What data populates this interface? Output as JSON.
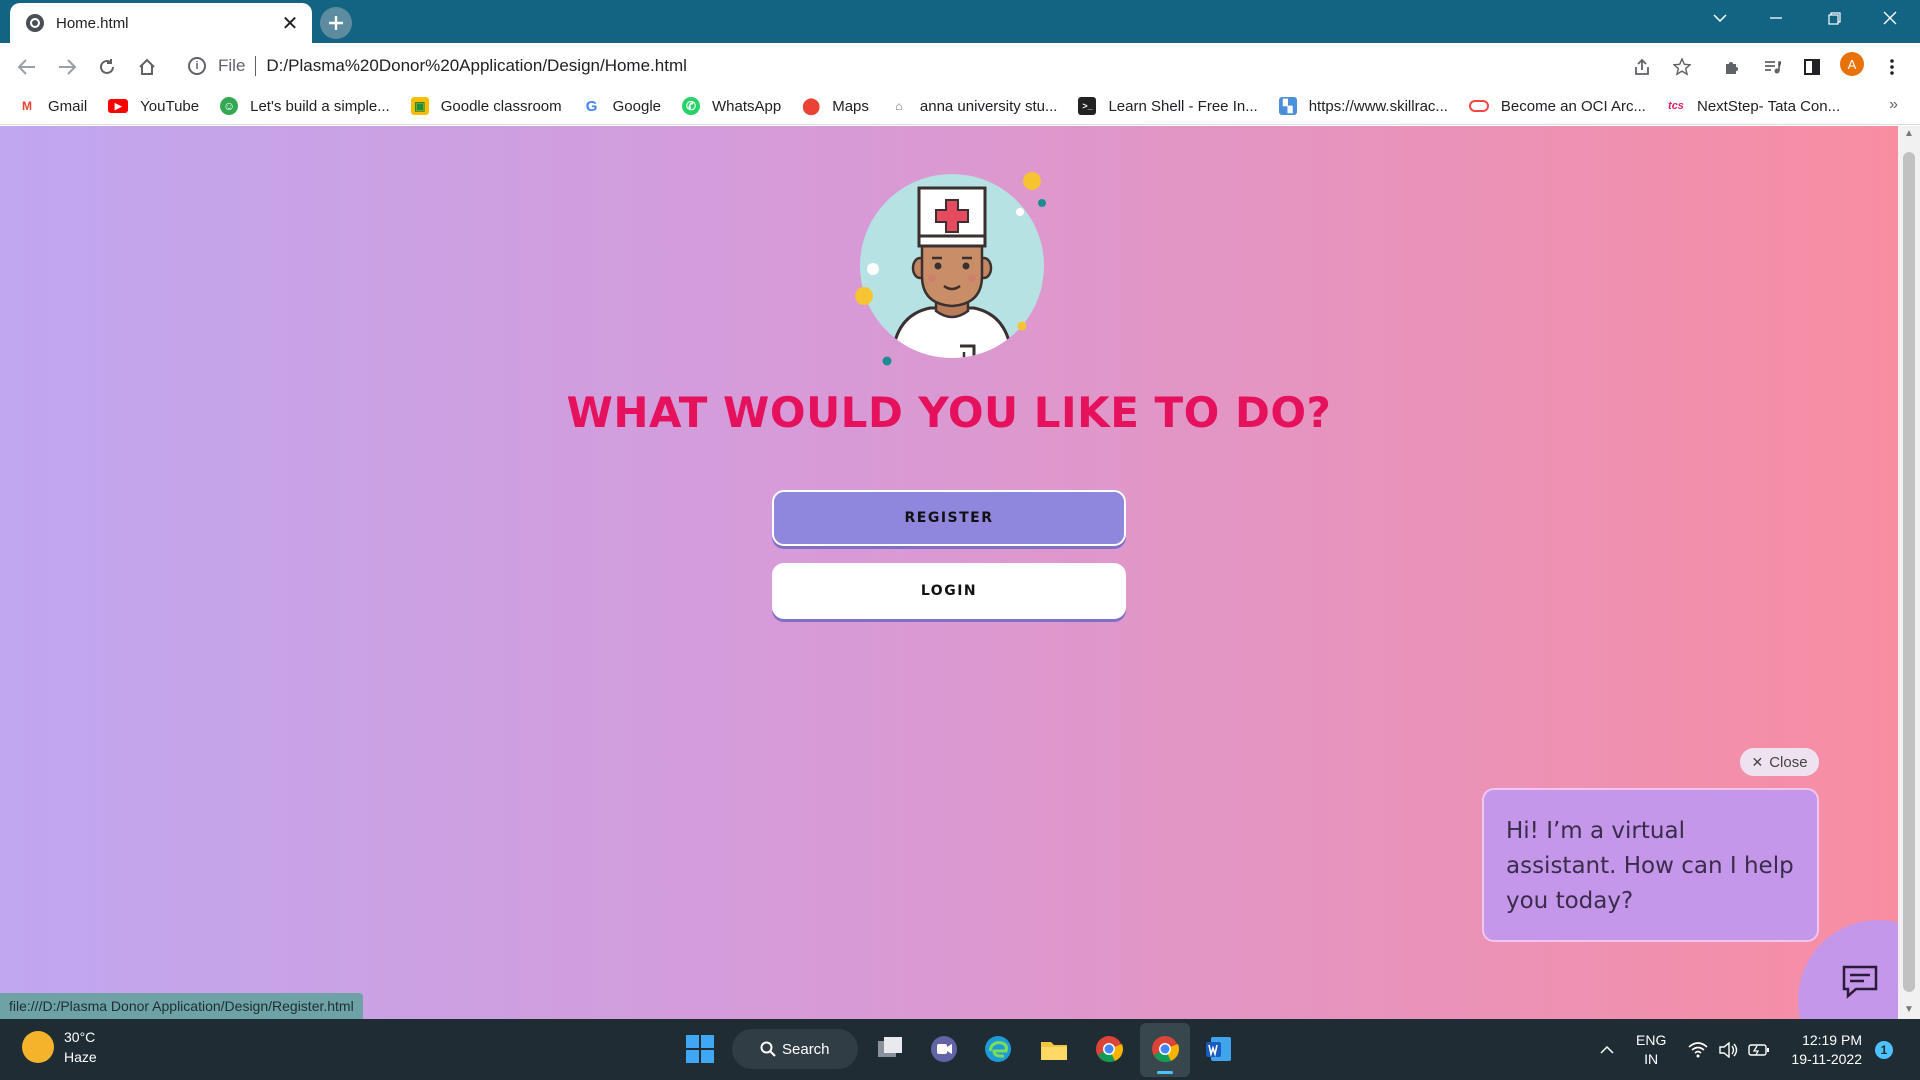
{
  "browser": {
    "tab_title": "Home.html",
    "url_scheme": "File",
    "url": "D:/Plasma%20Donor%20Application/Design/Home.html",
    "profile_initial": "A",
    "bookmarks": [
      {
        "label": "Gmail",
        "icon": "gmail-icon"
      },
      {
        "label": "YouTube",
        "icon": "youtube-icon"
      },
      {
        "label": "Let's build a simple...",
        "icon": "chat-icon"
      },
      {
        "label": "Goodle classroom",
        "icon": "classroom-icon"
      },
      {
        "label": "Google",
        "icon": "google-icon"
      },
      {
        "label": "WhatsApp",
        "icon": "whatsapp-icon"
      },
      {
        "label": "Maps",
        "icon": "maps-icon"
      },
      {
        "label": "anna university stu...",
        "icon": "university-icon"
      },
      {
        "label": "Learn Shell - Free In...",
        "icon": "terminal-icon"
      },
      {
        "label": "https://www.skillrac...",
        "icon": "skillrack-icon"
      },
      {
        "label": "Become an OCI Arc...",
        "icon": "oracle-icon"
      },
      {
        "label": "NextStep- Tata Con...",
        "icon": "tcs-icon"
      }
    ],
    "status_url": "file:///D:/Plasma Donor Application/Design/Register.html"
  },
  "page": {
    "heading": "WHAT WOULD YOU LIKE TO DO?",
    "register_label": "REGISTER",
    "login_label": "LOGIN",
    "chat": {
      "close_label": "Close",
      "message": "Hi! I’m a virtual assistant. How can I help you today?"
    }
  },
  "taskbar": {
    "temperature": "30°C",
    "weather": "Haze",
    "search_label": "Search",
    "lang_top": "ENG",
    "lang_bottom": "IN",
    "time": "12:19 PM",
    "date": "19-11-2022",
    "notification_count": "1"
  },
  "colors": {
    "tab_strip": "#136382",
    "heading": "#e6115c",
    "register_button": "#8f86de",
    "chat_bubble": "#c597ea"
  }
}
